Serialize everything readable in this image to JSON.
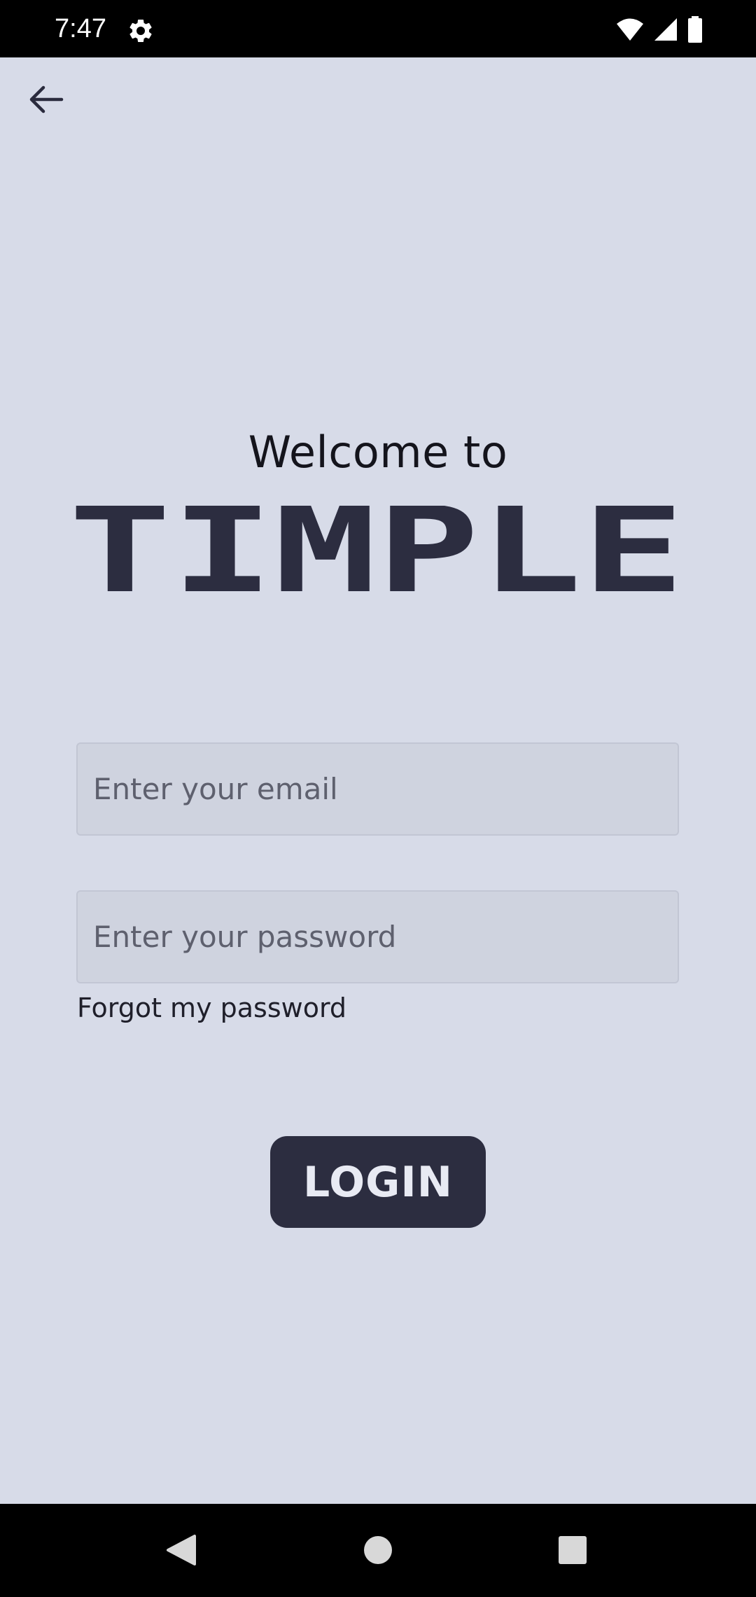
{
  "status_bar": {
    "time": "7:47",
    "icons": [
      "gear-icon",
      "wifi-icon",
      "signal-icon",
      "battery-icon"
    ]
  },
  "header": {
    "back_icon": "arrow-left-icon"
  },
  "main": {
    "welcome_text": "Welcome to",
    "logo_text": "TIMPLE",
    "email_placeholder": "Enter your email",
    "email_value": "",
    "password_placeholder": "Enter your password",
    "password_value": "",
    "forgot_label": "Forgot my password",
    "login_label": "LOGIN"
  },
  "nav_bar": {
    "icons": [
      "nav-back-icon",
      "nav-home-icon",
      "nav-recents-icon"
    ]
  },
  "colors": {
    "background": "#d7dbe8",
    "accent": "#2c2d40",
    "input_bg": "#cfd3df",
    "system_bars": "#000000"
  }
}
